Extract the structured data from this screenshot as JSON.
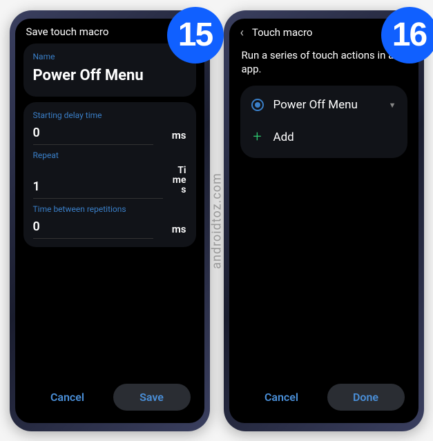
{
  "badges": {
    "left": "15",
    "right": "16"
  },
  "watermark": "androidtoz.com",
  "left_phone": {
    "header": "Save touch macro",
    "name_label": "Name",
    "name_value": "Power Off Menu",
    "delay_label": "Starting delay time",
    "delay_value": "0",
    "delay_unit": "ms",
    "repeat_label": "Repeat",
    "repeat_value": "1",
    "repeat_unit": "Times",
    "between_label": "Time between repetitions",
    "between_value": "0",
    "between_unit": "ms",
    "cancel": "Cancel",
    "save": "Save"
  },
  "right_phone": {
    "header": "Touch macro",
    "description": "Run a series of touch actions in an app.",
    "item_label": "Power Off Menu",
    "add_label": "Add",
    "cancel": "Cancel",
    "done": "Done"
  }
}
